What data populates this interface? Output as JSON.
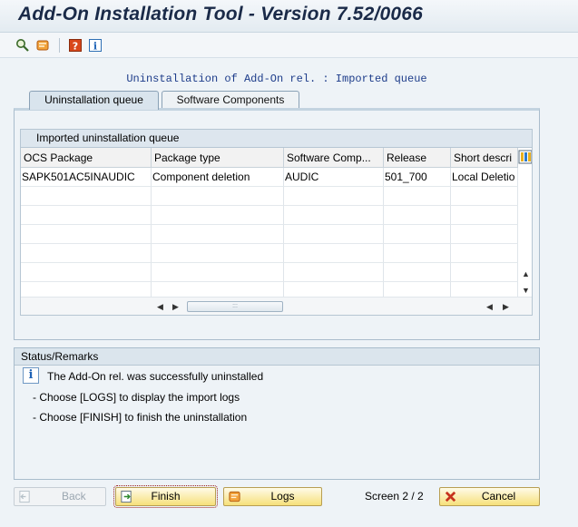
{
  "window": {
    "title": "Add-On Installation Tool - Version 7.52/0066"
  },
  "toolbar": {
    "icons": [
      "find-icon",
      "transport-icon",
      "help-icon",
      "info-icon"
    ]
  },
  "heading": "Uninstallation of Add-On rel. : Imported queue",
  "tabs": [
    {
      "label": "Uninstallation queue",
      "active": true
    },
    {
      "label": "Software Components",
      "active": false
    }
  ],
  "grid": {
    "title": "Imported uninstallation queue",
    "columns": [
      "OCS Package",
      "Package type",
      "Software Comp...",
      "Release",
      "Short descri"
    ],
    "rows": [
      [
        "SAPK501AC5INAUDIC",
        "Component deletion",
        "AUDIC",
        "501_700",
        "Local Deletio"
      ]
    ],
    "empty_rows": 6,
    "hscroll_grip": ":::"
  },
  "status": {
    "title": "Status/Remarks",
    "message": "The Add-On rel. was successfully uninstalled",
    "line1": "- Choose [LOGS] to display the import logs",
    "line2": "- Choose [FINISH] to finish the uninstallation"
  },
  "footer": {
    "back_label": "Back",
    "finish_label": "Finish",
    "logs_label": "Logs",
    "screen_label": "Screen 2 / 2",
    "cancel_label": "Cancel"
  },
  "colors": {
    "accent_title": "#1a2a48",
    "button_yellow": "#f6e07a",
    "heading_blue": "#1d3c8a"
  }
}
